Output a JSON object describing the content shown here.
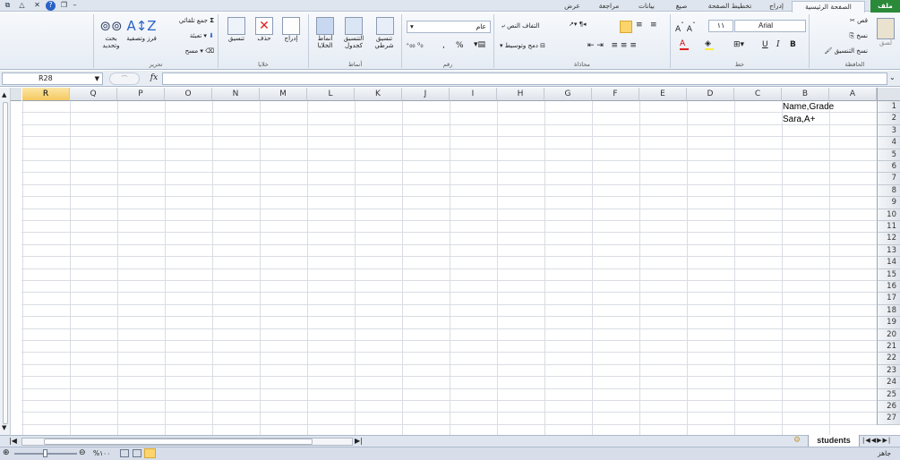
{
  "tabs": [
    "ملف",
    "الصفحة الرئيسية",
    "إدراج",
    "تخطيط الصفحة",
    "صيغ",
    "بيانات",
    "مراجعة",
    "عرض"
  ],
  "ribbon": {
    "clipboard": {
      "group": "الحافظة",
      "paste": "لصق",
      "cut": "قص",
      "copy": "نسخ",
      "format_painter": "نسخ التنسيق"
    },
    "font": {
      "group": "خط",
      "font_name": "Arial",
      "font_size": "١١",
      "bold": "B",
      "italic": "I",
      "underline": "U"
    },
    "alignment": {
      "group": "محاذاة",
      "wrap": "التفاف النص",
      "merge": "دمج وتوسيط"
    },
    "number": {
      "group": "رقم",
      "format": "عام",
      "percent": "%",
      "comma": ","
    },
    "styles": {
      "group": "أنماط",
      "conditional": "تنسيق شرطي",
      "table": "التنسيق كجدول",
      "cell_styles": "أنماط الخلايا"
    },
    "cells": {
      "group": "خلايا",
      "insert": "إدراج",
      "delete": "حذف",
      "format": "تنسيق"
    },
    "editing": {
      "group": "تحرير",
      "autosum": "جمع تلقائي",
      "fill": "تعبئة",
      "clear": "مسح",
      "sort": "فرز وتصفية",
      "find": "بحث وتحديد"
    }
  },
  "formula_bar": {
    "name_box": "R28",
    "fx": "fx",
    "formula": ""
  },
  "columns": [
    "A",
    "B",
    "C",
    "D",
    "E",
    "F",
    "G",
    "H",
    "I",
    "J",
    "K",
    "L",
    "M",
    "N",
    "O",
    "P",
    "Q",
    "R"
  ],
  "selected_column": "R",
  "rows": [
    "1",
    "2",
    "3",
    "4",
    "5",
    "6",
    "7",
    "8",
    "9",
    "10",
    "11",
    "12",
    "13",
    "14",
    "15",
    "16",
    "17",
    "18",
    "19",
    "20",
    "21",
    "22",
    "23",
    "24",
    "25",
    "26",
    "27"
  ],
  "cells": {
    "B1": "Name,Grade",
    "B2": "Sara,A+"
  },
  "sheet_tab": "students",
  "status": {
    "ready": "جاهز",
    "zoom": "%١٠٠"
  },
  "colors": {
    "file_tab": "#2a8a3a",
    "selected_header": "#f5c860"
  }
}
